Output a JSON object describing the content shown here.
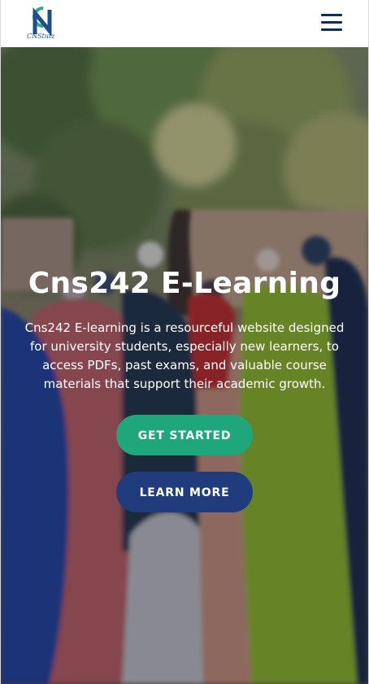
{
  "header": {
    "logo_text": "CNStutz",
    "menu_icon": "hamburger-menu-icon"
  },
  "hero": {
    "title": "Cns242 E-Learning",
    "description": "Cns242 E-learning is a resourceful website designed for university students, especially new learners, to access PDFs, past exams, and valuable course materials that support their academic growth.",
    "primary_button": "GET STARTED",
    "secondary_button": "LEARN MORE"
  },
  "colors": {
    "primary_button": "#1fa67a",
    "secondary_button": "#203c7c",
    "menu_icon": "#0d2d5c"
  }
}
